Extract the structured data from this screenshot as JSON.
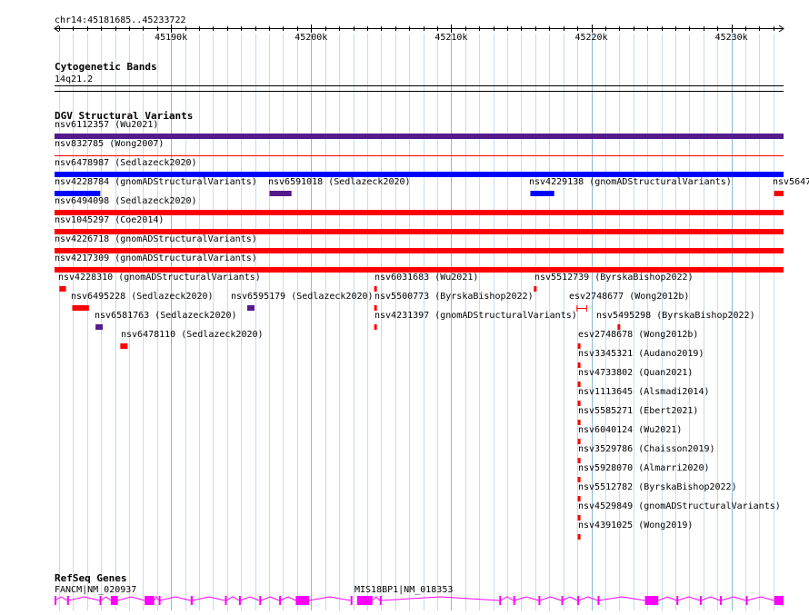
{
  "ruler": {
    "location": "chr14:45181685..45233722",
    "ticks": [
      "45190k",
      "45200k",
      "45210k",
      "45220k",
      "45230k"
    ]
  },
  "tracks": {
    "cytobands": {
      "title": "Cytogenetic Bands",
      "band_label": "14q21.2"
    },
    "dgv": {
      "title": "DGV Structural Variants",
      "colors": {
        "loss": "#ff0000",
        "gain": "#0000ff",
        "complex": "#551a8b"
      },
      "features": [
        {
          "label": "nsv6112357 (Wu2021)",
          "color": "complex",
          "start": 45181685,
          "end": 45233722,
          "shape": "bar"
        },
        {
          "label": "nsv832785 (Wong2007)",
          "color": "loss",
          "start": 45181685,
          "end": 45233722,
          "shape": "line"
        },
        {
          "label": "nsv6478987 (Sedlazeck2020)",
          "color": "gain",
          "start": 45181685,
          "end": 45233722,
          "shape": "bar"
        },
        {
          "label": "nsv4228784 (gnomADStructuralVariants)",
          "color": "gain",
          "start": 45181685,
          "end": 45184950,
          "shape": "bar"
        },
        {
          "label": "nsv6591018 (Sedlazeck2020)",
          "color": "complex",
          "start": 45197030,
          "end": 45198600,
          "shape": "bar"
        },
        {
          "label": "nsv4229138 (gnomADStructuralVariants)",
          "color": "gain",
          "start": 45215650,
          "end": 45217350,
          "shape": "bar"
        },
        {
          "label": "nsv5647",
          "color": "loss",
          "start": 45233050,
          "end": 45233722,
          "shape": "bar"
        },
        {
          "label": "nsv6494098 (Sedlazeck2020)",
          "color": "loss",
          "start": 45181685,
          "end": 45233722,
          "shape": "bar"
        },
        {
          "label": "nsv1045297 (Coe2014)",
          "color": "loss",
          "start": 45181685,
          "end": 45233722,
          "shape": "bar"
        },
        {
          "label": "nsv4226718 (gnomADStructuralVariants)",
          "color": "loss",
          "start": 45181685,
          "end": 45233722,
          "shape": "bar"
        },
        {
          "label": "nsv4217309 (gnomADStructuralVariants)",
          "color": "loss",
          "start": 45181685,
          "end": 45233722,
          "shape": "bar"
        },
        {
          "label": "nsv4228310 (gnomADStructuralVariants)",
          "color": "loss",
          "start": 45182030,
          "end": 45182500,
          "shape": "bar"
        },
        {
          "label": "nsv6031683 (Wu2021)",
          "color": "loss",
          "start": 45204500,
          "end": 45204600,
          "shape": "bar"
        },
        {
          "label": "nsv5512739 (ByrskaBishop2022)",
          "color": "loss",
          "start": 45215900,
          "end": 45216000,
          "shape": "bar"
        },
        {
          "label": "nsv6495228 (Sedlazeck2020)",
          "color": "loss",
          "start": 45182950,
          "end": 45184140,
          "shape": "bar"
        },
        {
          "label": "nsv6595179 (Sedlazeck2020)",
          "color": "complex",
          "start": 45195440,
          "end": 45195960,
          "shape": "bar"
        },
        {
          "label": "nsv5500773 (ByrskaBishop2022)",
          "color": "loss",
          "start": 45204500,
          "end": 45204600,
          "shape": "bar"
        },
        {
          "label": "esv2748677 (Wong2012b)",
          "color": "loss",
          "start": 45218950,
          "end": 45219700,
          "shape": "range"
        },
        {
          "label": "nsv6581763 (Sedlazeck2020)",
          "color": "complex",
          "start": 45184610,
          "end": 45185130,
          "shape": "bar"
        },
        {
          "label": "nsv4231397 (gnomADStructuralVariants)",
          "color": "loss",
          "start": 45204500,
          "end": 45204600,
          "shape": "bar"
        },
        {
          "label": "nsv5495298 (ByrskaBishop2022)",
          "color": "loss",
          "start": 45221870,
          "end": 45222050,
          "shape": "bar"
        },
        {
          "label": "nsv6478110 (Sedlazeck2020)",
          "color": "loss",
          "start": 45186380,
          "end": 45186900,
          "shape": "bar"
        },
        {
          "label": "esv2748678 (Wong2012b)",
          "color": "loss",
          "start": 45219030,
          "end": 45219180,
          "shape": "bar"
        },
        {
          "label": "nsv3345321 (Audano2019)",
          "color": "loss",
          "start": 45219030,
          "end": 45219110,
          "shape": "bar"
        },
        {
          "label": "nsv4733802 (Quan2021)",
          "color": "loss",
          "start": 45219030,
          "end": 45219110,
          "shape": "bar"
        },
        {
          "label": "nsv1113645 (Alsmadi2014)",
          "color": "loss",
          "start": 45219030,
          "end": 45219110,
          "shape": "bar"
        },
        {
          "label": "nsv5585271 (Ebert2021)",
          "color": "loss",
          "start": 45219030,
          "end": 45219110,
          "shape": "bar"
        },
        {
          "label": "nsv6040124 (Wu2021)",
          "color": "loss",
          "start": 45219030,
          "end": 45219110,
          "shape": "bar"
        },
        {
          "label": "nsv3529786 (Chaisson2019)",
          "color": "loss",
          "start": 45219030,
          "end": 45219110,
          "shape": "bar"
        },
        {
          "label": "nsv5928070 (Almarri2020)",
          "color": "loss",
          "start": 45219030,
          "end": 45219110,
          "shape": "bar"
        },
        {
          "label": "nsv5512782 (ByrskaBishop2022)",
          "color": "loss",
          "start": 45219030,
          "end": 45219110,
          "shape": "bar"
        },
        {
          "label": "nsv4529849 (gnomADStructuralVariants)",
          "color": "loss",
          "start": 45219030,
          "end": 45219110,
          "shape": "bar"
        },
        {
          "label": "nsv4391025 (Wong2019)",
          "color": "loss",
          "start": 45219030,
          "end": 45219110,
          "shape": "bar"
        }
      ]
    },
    "refseq": {
      "title": "RefSeq Genes",
      "color": "#ff00ff",
      "genes": [
        {
          "label": "FANCM|NM_020937",
          "start": 45181685,
          "end": 45202900,
          "exons": [
            [
              45181685,
              45181740
            ],
            [
              45182580,
              45182700
            ],
            [
              45184900,
              45185000
            ],
            [
              45185700,
              45186200
            ],
            [
              45188120,
              45188800
            ],
            [
              45189120,
              45189200
            ],
            [
              45191400,
              45191550
            ],
            [
              45193850,
              45193950
            ],
            [
              45194850,
              45194950
            ],
            [
              45196300,
              45196420
            ],
            [
              45197720,
              45197800
            ],
            [
              45198900,
              45199850
            ],
            [
              45202820,
              45202900
            ]
          ]
        },
        {
          "label": "MIS18BP1|NM_018353",
          "start": 45203280,
          "end": 45233722,
          "exons": [
            [
              45203280,
              45204380
            ],
            [
              45204900,
              45205000
            ],
            [
              45213430,
              45213510
            ],
            [
              45214430,
              45214510
            ],
            [
              45216230,
              45216300
            ],
            [
              45217860,
              45217930
            ],
            [
              45219000,
              45219080
            ],
            [
              45220450,
              45220530
            ],
            [
              45223830,
              45224780
            ],
            [
              45226080,
              45226160
            ],
            [
              45227750,
              45227830
            ],
            [
              45229180,
              45229260
            ],
            [
              45231030,
              45231110
            ],
            [
              45233060,
              45233722
            ]
          ]
        }
      ]
    }
  }
}
